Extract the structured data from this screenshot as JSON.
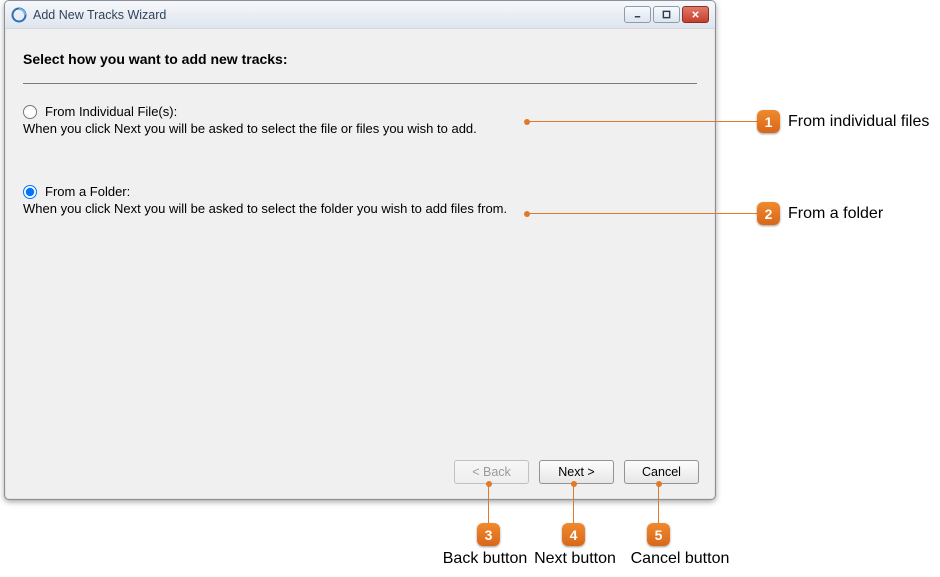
{
  "window": {
    "title": "Add New Tracks Wizard"
  },
  "content": {
    "prompt": "Select how you want to add new tracks:",
    "option1": {
      "label": "From Individual File(s):",
      "desc": "When you click Next you will be asked to select the file or files you wish to add."
    },
    "option2": {
      "label": "From a Folder:",
      "desc": "When you click Next you will be asked to select the folder you wish to add files from."
    },
    "selected": "folder"
  },
  "buttons": {
    "back": "< Back",
    "next": "Next >",
    "cancel": "Cancel"
  },
  "callouts": {
    "c1": {
      "num": "1",
      "label": "From individual files"
    },
    "c2": {
      "num": "2",
      "label": "From a folder"
    },
    "c3": {
      "num": "3",
      "label": "Back button"
    },
    "c4": {
      "num": "4",
      "label": "Next button"
    },
    "c5": {
      "num": "5",
      "label": "Cancel button"
    }
  }
}
